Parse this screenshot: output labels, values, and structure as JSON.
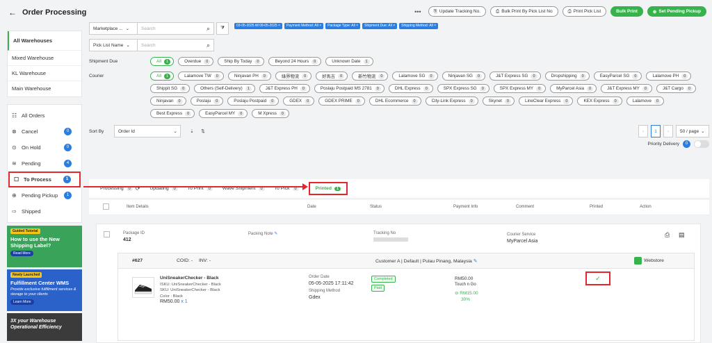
{
  "header": {
    "title": "Order Processing",
    "back": "←",
    "more": "•••",
    "update_tracking": "Update Tracking No.",
    "bulk_print_pick": "Bulk Print By Pick List No",
    "print_pick_list": "Print Pick List",
    "bulk_print": "Bulk Print",
    "set_pending": "Set Pending Pickup"
  },
  "warehouses": [
    "All Warehouses",
    "Mixed Warehouse",
    "KL Warehouse",
    "Main Warehouse"
  ],
  "order_nav": [
    {
      "label": "All Orders",
      "icon": "☷",
      "count": ""
    },
    {
      "label": "Cancel",
      "icon": "⊗",
      "count": "0"
    },
    {
      "label": "On Hold",
      "icon": "⊙",
      "count": "0"
    },
    {
      "label": "Pending",
      "icon": "≋",
      "count": "4"
    },
    {
      "label": "To Process",
      "icon": "☐",
      "count": "1"
    },
    {
      "label": "Pending Pickup",
      "icon": "⊕",
      "count": "1"
    },
    {
      "label": "Shipped",
      "icon": "⇨",
      "count": ""
    }
  ],
  "ads": {
    "a1_tag": "Guided Tutorial",
    "a1_title": "How to use the New Shipping Label?",
    "a1_btn": "Read More",
    "a2_tag": "Newly Launched",
    "a2_title": "Fulfillment Center WMS",
    "a2_sub": "Provide exclusive fulfillment services & storage to your clients",
    "a2_btn": "Learn More",
    "a3_title": "3X your Warehouse Operational Efficiency"
  },
  "filters": {
    "marketplace": "Marketplace ...",
    "search_ph": "Search",
    "picklist": "Pick List Name",
    "chips": [
      "03-05-2025 till 09-05-2025 ×",
      "Payment Method: All ×",
      "Package Type: All ×",
      "Shipment Due: All ×",
      "Shipping Method: All ×"
    ],
    "shipment_due_label": "Shipment Due",
    "shipment_due": [
      {
        "l": "All",
        "n": "1",
        "on": true
      },
      {
        "l": "Overdue",
        "n": "0"
      },
      {
        "l": "Ship By Today",
        "n": "0"
      },
      {
        "l": "Beyond 24 Hours",
        "n": "0"
      },
      {
        "l": "Unknown Date",
        "n": "1"
      }
    ],
    "courier_label": "Courier",
    "couriers": [
      {
        "l": "All",
        "n": "1",
        "on": true
      },
      {
        "l": "Lalamove TW",
        "n": "0"
      },
      {
        "l": "Ninjavan PH",
        "n": "0"
      },
      {
        "l": "綠界物流",
        "n": "0"
      },
      {
        "l": "好馬吉",
        "n": "0"
      },
      {
        "l": "新竹物流",
        "n": "0"
      },
      {
        "l": "Lalamove SG",
        "n": "0"
      },
      {
        "l": "Ninjavan SG",
        "n": "0"
      },
      {
        "l": "J&T Express SG",
        "n": "0"
      },
      {
        "l": "Dropshipping",
        "n": "0"
      },
      {
        "l": "EasyParcel SG",
        "n": "0"
      },
      {
        "l": "Lalamove PH",
        "n": "0"
      },
      {
        "l": "Shippit SG",
        "n": "0"
      },
      {
        "l": "Others (Self-Delivery)",
        "n": "1"
      },
      {
        "l": "J&T Express PH",
        "n": "0"
      },
      {
        "l": "Poslaju Postpaid MS 2781",
        "n": "0"
      },
      {
        "l": "DHL Express",
        "n": "0"
      },
      {
        "l": "SPX Express SG",
        "n": "0"
      },
      {
        "l": "SPX Express MY",
        "n": "0"
      },
      {
        "l": "MyParcel Asia",
        "n": "0"
      },
      {
        "l": "J&T Express MY",
        "n": "0"
      },
      {
        "l": "J&T Cargo",
        "n": "0"
      },
      {
        "l": "Ninjavan",
        "n": "0"
      },
      {
        "l": "Poslaju",
        "n": "0"
      },
      {
        "l": "Poslaju Postpaid",
        "n": "0"
      },
      {
        "l": "GDEX",
        "n": "0"
      },
      {
        "l": "GDEX PRIME",
        "n": "0"
      },
      {
        "l": "DHL Ecommerce",
        "n": "0"
      },
      {
        "l": "City-Link Express",
        "n": "0"
      },
      {
        "l": "Skynet",
        "n": "0"
      },
      {
        "l": "LineClear Express",
        "n": "0"
      },
      {
        "l": "KEX Express",
        "n": "0"
      },
      {
        "l": "Lalamove",
        "n": "0"
      },
      {
        "l": "Best Express",
        "n": "0"
      },
      {
        "l": "EasyParcel MY",
        "n": "0"
      },
      {
        "l": "M Xpress",
        "n": "0"
      }
    ],
    "sort_by": "Sort By",
    "sort_field": "Order Id",
    "page": "1",
    "per_page": "50 / page",
    "priority": "Priority Delivery",
    "priority_n": "0"
  },
  "tabs": [
    {
      "l": "Processing",
      "n": "0"
    },
    {
      "l": "Updating",
      "n": "0"
    },
    {
      "l": "To Print",
      "n": "0"
    },
    {
      "l": "Wave Shipment",
      "n": "0"
    },
    {
      "l": "To Pick",
      "n": "0"
    },
    {
      "l": "Printed",
      "n": "1"
    }
  ],
  "columns": [
    "Item Details",
    "Date",
    "Status",
    "Payment Info",
    "Comment",
    "Printed",
    "Action"
  ],
  "package": {
    "id_label": "Package ID",
    "id": "412",
    "note_label": "Packing Note",
    "tracking_label": "Tracking No",
    "tracking": "",
    "courier_label": "Courier Service",
    "courier": "MyParcel Asia"
  },
  "order": {
    "no": "#627",
    "cod": "COID: -",
    "inv": "INV: -",
    "customer": "Customer A | Default | Pulau Pinang, Malaysia",
    "store": "Webstore",
    "product": "UniSneakerChecker - Black",
    "isku": "ISKU: UniSneakerChecker - Black",
    "sku": "SKU: UniSneakerChecker - Black",
    "color": "Color : Black",
    "price": "RM50.00",
    "qty": "x 1",
    "date_label": "Order Date",
    "date": "05-05-2025 17:11:42",
    "ship_label": "Shipping Method",
    "ship": "Gdex",
    "status1": "Completed",
    "status2": "Paid",
    "pay": "RM50.00",
    "pay_method": "Touch n Go",
    "fee": "RM15.00",
    "pct": "30%",
    "printed": "✓"
  }
}
